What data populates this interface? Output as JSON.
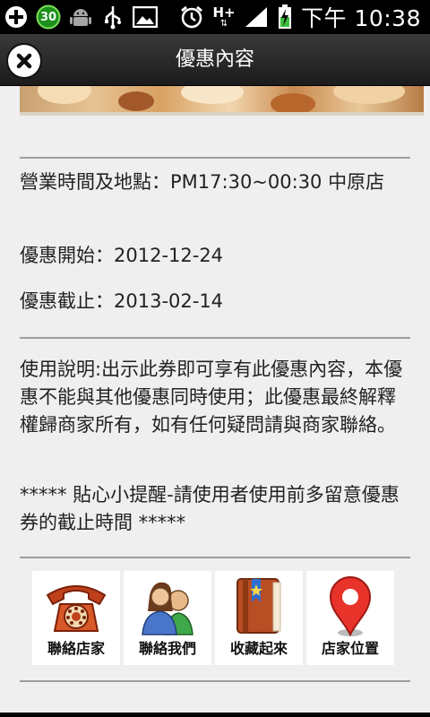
{
  "status_bar": {
    "icons": [
      "add-icon",
      "badge-30-icon",
      "android-icon",
      "usb-icon",
      "image-icon",
      "alarm-icon",
      "data-hplus-icon",
      "signal-icon",
      "battery-charging-icon"
    ],
    "badge_text": "30",
    "network_text": "H+",
    "time": "下午 10:38"
  },
  "header": {
    "title": "優惠內容",
    "close_icon": "close-icon"
  },
  "details": {
    "hours_location": "營業時間及地點：PM17:30~00:30 中原店",
    "start": "優惠開始：2012-12-24",
    "end": "優惠截止：2013-02-14"
  },
  "notes": {
    "usage": "使用說明:出示此券即可享有此優惠內容，本優惠不能與其他優惠同時使用；此優惠最終解釋權歸商家所有，如有任何疑問請與商家聯絡。",
    "reminder": "***** 貼心小提醒-請使用者使用前多留意優惠券的截止時間 *****"
  },
  "actions": [
    {
      "label": "聯絡店家",
      "icon": "telephone-icon"
    },
    {
      "label": "聯絡我們",
      "icon": "people-icon"
    },
    {
      "label": "收藏起來",
      "icon": "bookmark-book-icon"
    },
    {
      "label": "店家位置",
      "icon": "map-pin-icon"
    }
  ],
  "colors": {
    "header_bg": "#222222",
    "page_bg": "#efefef",
    "divider": "#9e9e9e",
    "pin_red": "#e8332a",
    "book_orange": "#c8582a"
  }
}
